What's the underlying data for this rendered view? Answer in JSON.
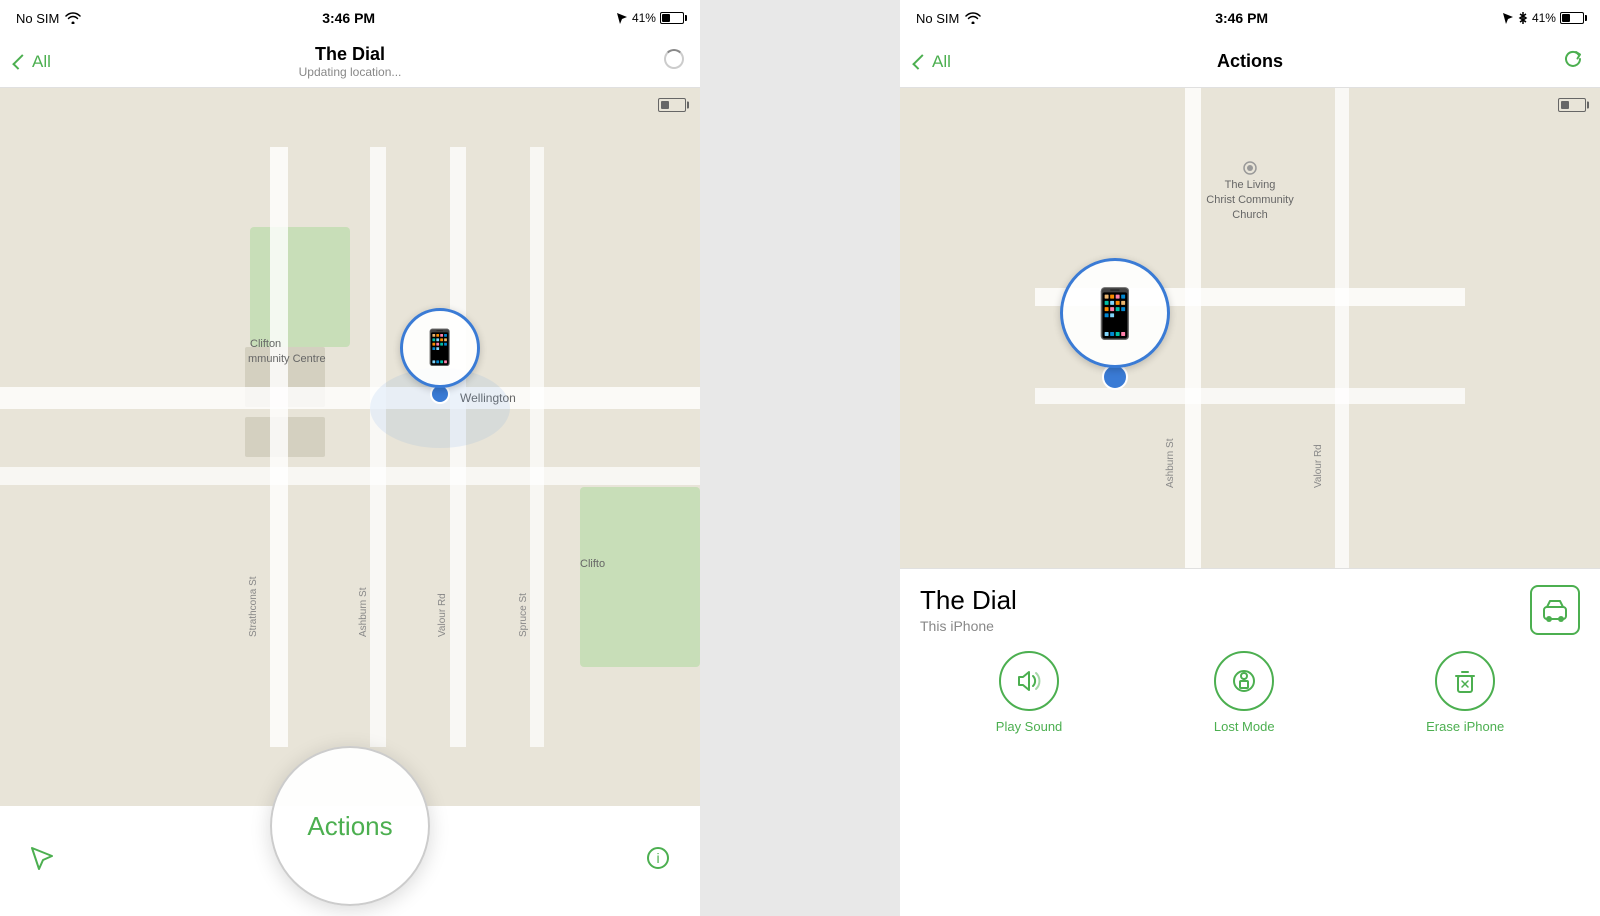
{
  "screen1": {
    "statusBar": {
      "noSim": "No SIM",
      "time": "3:46 PM",
      "battery": "41%"
    },
    "navBar": {
      "backLabel": "All",
      "title": "The Dial",
      "subtitle": "Updating location..."
    },
    "map": {
      "labels": [
        "Wellington",
        "Clifton",
        "Community Centre",
        "Clifton",
        "Strathcona St",
        "Ashburn St",
        "Valour Rd",
        "Spruce St"
      ]
    },
    "bottomBar": {
      "actionsLabel": "Actions"
    }
  },
  "screen2": {
    "statusBar": {
      "noSim": "No SIM",
      "time": "3:46 PM",
      "battery": "41%"
    },
    "navBar": {
      "backLabel": "All",
      "title": "Actions"
    },
    "map": {
      "churchLabel": "The Living\nChrist Community\nChurch",
      "streetLabels": [
        "Ashburn St",
        "Valour Rd"
      ]
    },
    "deviceInfo": {
      "name": "The Dial",
      "type": "This iPhone"
    },
    "actions": [
      {
        "label": "Play Sound",
        "icon": "🔊"
      },
      {
        "label": "Lost Mode",
        "icon": "🔒"
      },
      {
        "label": "Erase iPhone",
        "icon": "🗑"
      }
    ]
  }
}
